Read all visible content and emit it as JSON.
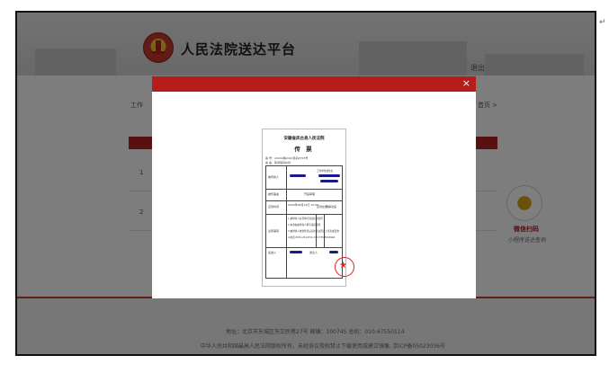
{
  "header": {
    "title": "人民法院送达平台",
    "logout_label": "退出"
  },
  "page": {
    "breadcrumb_left": "工作",
    "breadcrumb_right": "首页 >",
    "rows": [
      "1",
      "2"
    ]
  },
  "qr": {
    "title": "微信扫码",
    "subtitle": "小程序送达查询"
  },
  "footer": {
    "address": "地址：北京市东城区东交民巷27号   邮编：100745   总机：010-67550114",
    "copyright": "中华人民共和国最高人民法院版权所有，未经协议授权禁止下载使用或建立镜像, 京ICP备05023036号"
  },
  "modal": {
    "close_label": "×"
  },
  "document": {
    "court": "安徽省凤台县人民法院",
    "title": "传 票",
    "case_no": "案 号：(2020)皖0421民初2753号",
    "cause": "案 由：民间借贷纠纷",
    "summoned_label": "被传唤人",
    "address_label": "工作单位或住址",
    "reason_label": "被传事由",
    "reason_value": "开庭审理",
    "time_label": "应到时间",
    "time_value": "2020年08月12日 15:00",
    "place_label": "应到处所",
    "place_value": "调解法庭",
    "notes_label": "注意事项",
    "notes": [
      "1.被传唤人必须准时到达应到处所",
      "2.本票由被传唤人携带来院报到",
      "3.被传唤人收到传票后应在送达回证上签名或盖章",
      "4.电话 0554-2314734  2317735  8393964"
    ],
    "issuer_label": "签发人",
    "server_label": "送达人"
  }
}
